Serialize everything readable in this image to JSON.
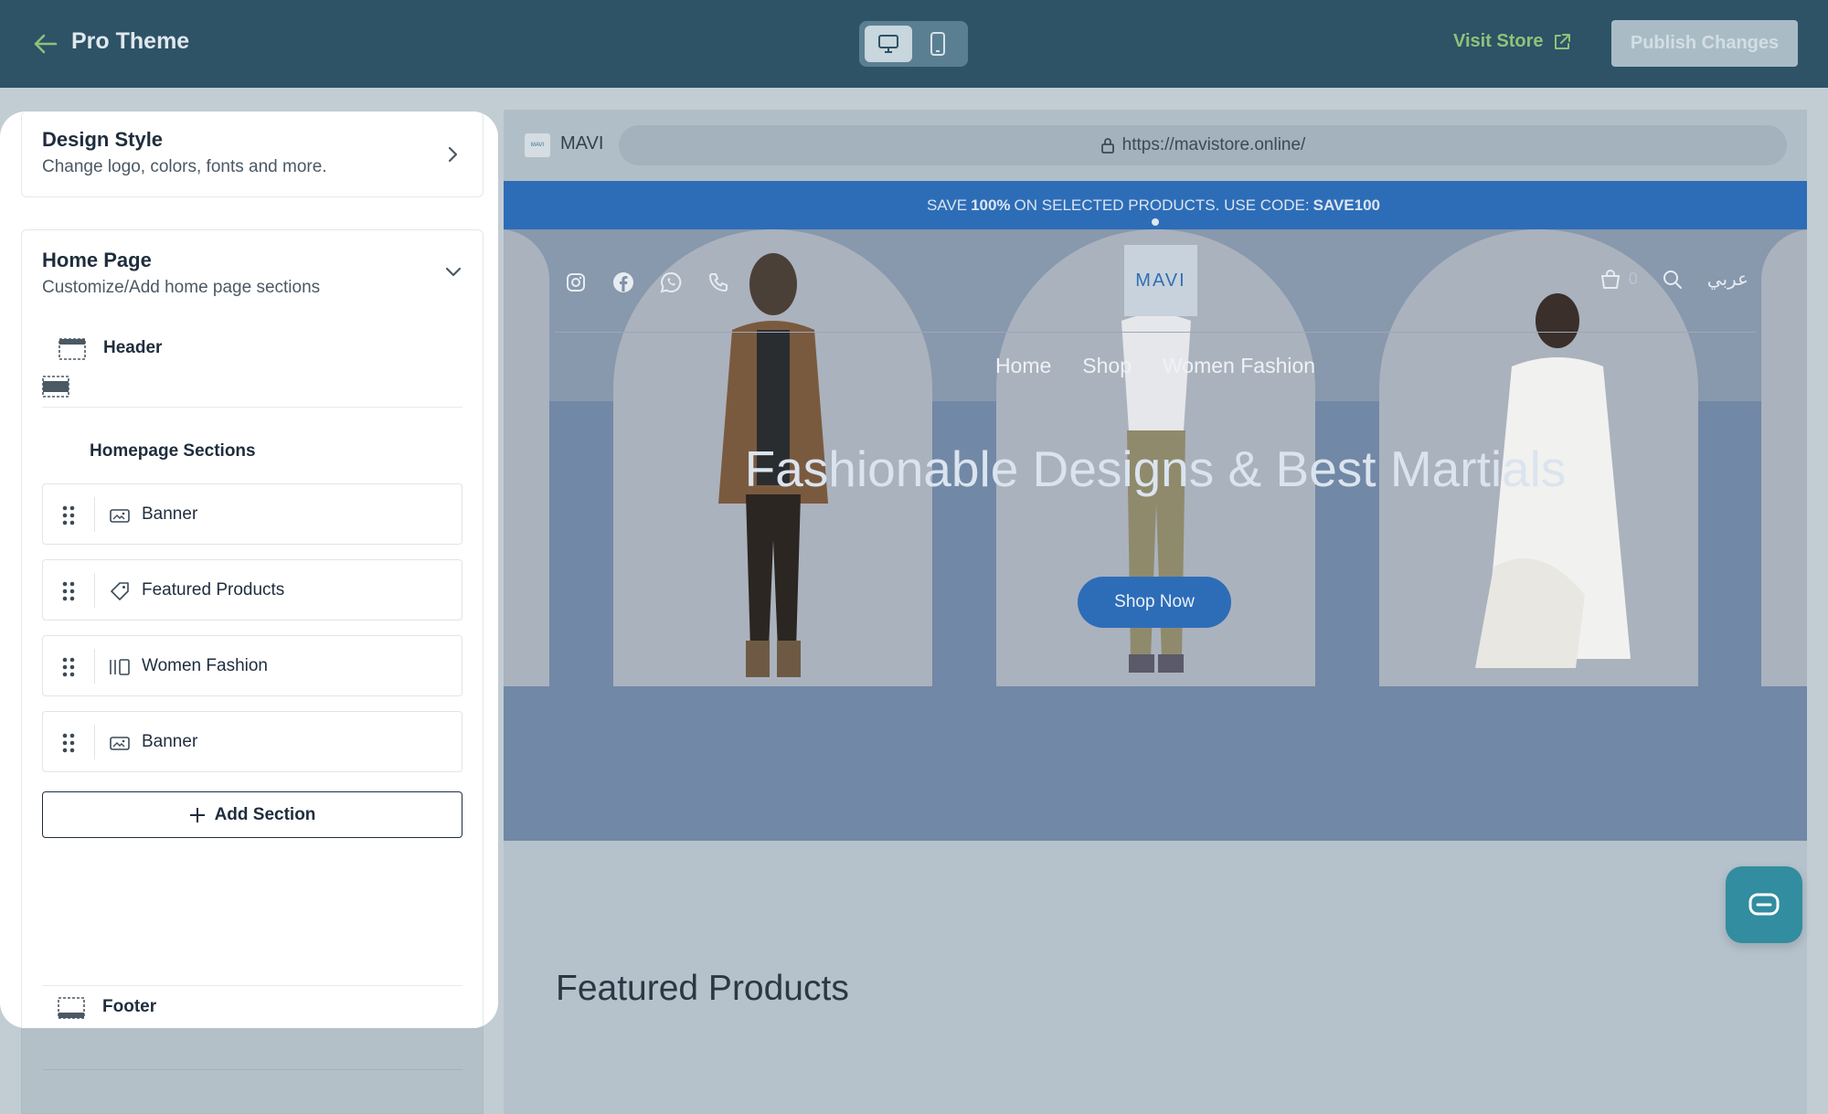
{
  "topbar": {
    "title": "Pro Theme",
    "visit_store": "Visit Store",
    "publish": "Publish Changes"
  },
  "design_style": {
    "title": "Design Style",
    "subtitle": "Change logo, colors, fonts and more."
  },
  "home_page": {
    "title": "Home Page",
    "subtitle": "Customize/Add home page sections",
    "header_label": "Header",
    "sections_label": "Homepage Sections",
    "sections": [
      {
        "label": "Banner",
        "icon": "image-icon"
      },
      {
        "label": "Featured Products",
        "icon": "tag-icon"
      },
      {
        "label": "Women Fashion",
        "icon": "columns-icon"
      },
      {
        "label": "Banner",
        "icon": "image-icon"
      }
    ],
    "add_section": "Add Section",
    "footer_label": "Footer"
  },
  "preview": {
    "site_name": "MAVI",
    "favicon_text": "MAVI",
    "url": "https://mavistore.online/",
    "promo_prefix": "SAVE",
    "promo_bold1": "100%",
    "promo_middle": "ON SELECTED PRODUCTS. USE CODE:",
    "promo_bold2": "SAVE100",
    "logo": "MAVI",
    "cart_count": "0",
    "lang": "عربي",
    "nav": [
      "Home",
      "Shop",
      "Women Fashion"
    ],
    "hero_title": "Fashionable Designs & Best Martials",
    "shop_now": "Shop Now",
    "featured_title": "Featured Products"
  },
  "colors": {
    "topbar": "#2e5266",
    "accent_green": "#8fc27a",
    "brand_blue": "#2d6db8",
    "chat": "#318d9f"
  }
}
